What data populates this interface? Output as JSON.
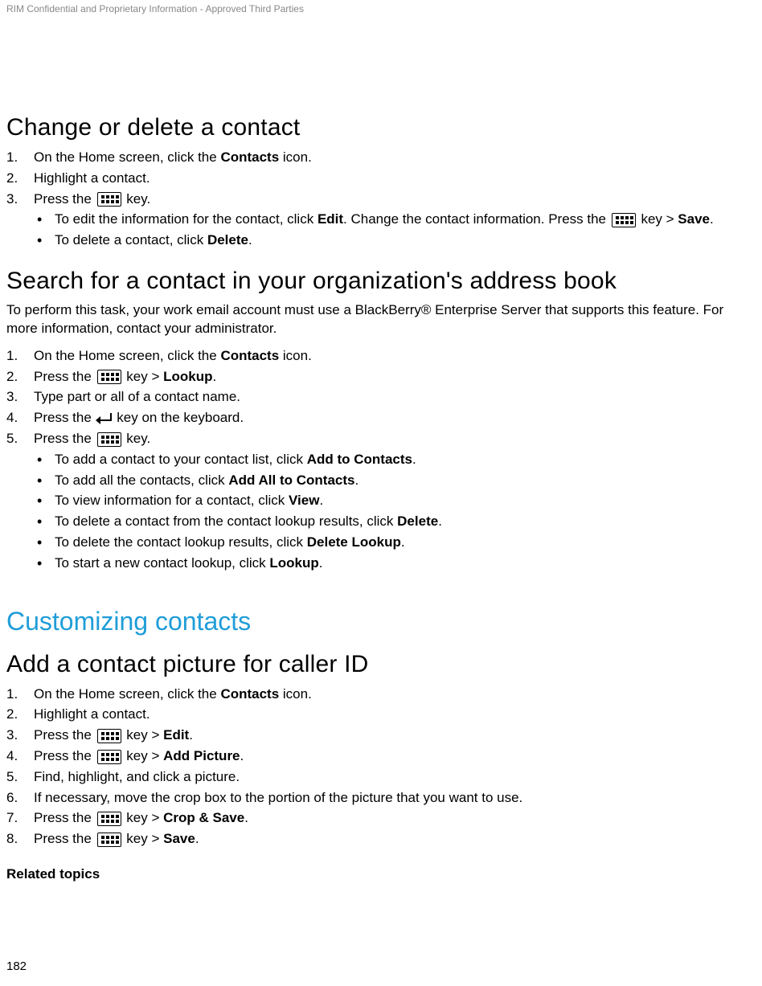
{
  "header": {
    "confidential": "RIM Confidential and Proprietary Information - Approved Third Parties"
  },
  "s1": {
    "title": "Change or delete a contact",
    "step1_a": "On the Home screen, click the ",
    "step1_b": "Contacts",
    "step1_c": " icon.",
    "step2": "Highlight a contact.",
    "step3_a": "Press the ",
    "step3_b": " key.",
    "b1_a": "To edit the information for the contact, click ",
    "b1_b": "Edit",
    "b1_c": ". Change the contact information. Press the ",
    "b1_d": " key > ",
    "b1_e": "Save",
    "b1_f": ".",
    "b2_a": "To delete a contact, click ",
    "b2_b": "Delete",
    "b2_c": "."
  },
  "s2": {
    "title": "Search for a contact in your organization's address book",
    "intro": "To perform this task, your work email account must use a BlackBerry® Enterprise Server that supports this feature. For more information, contact your administrator.",
    "step1_a": "On the Home screen, click the ",
    "step1_b": "Contacts",
    "step1_c": " icon.",
    "step2_a": "Press the ",
    "step2_b": " key > ",
    "step2_c": "Lookup",
    "step2_d": ".",
    "step3": "Type part or all of a contact name.",
    "step4_a": "Press the ",
    "step4_b": " key on the keyboard.",
    "step5_a": "Press the ",
    "step5_b": " key.",
    "b1_a": "To add a contact to your contact list, click ",
    "b1_b": "Add to Contacts",
    "b1_c": ".",
    "b2_a": "To add all the contacts, click ",
    "b2_b": "Add All to Contacts",
    "b2_c": ".",
    "b3_a": "To view information for a contact, click ",
    "b3_b": "View",
    "b3_c": ".",
    "b4_a": "To delete a contact from the contact lookup results, click ",
    "b4_b": "Delete",
    "b4_c": ".",
    "b5_a": "To delete the contact lookup results, click ",
    "b5_b": "Delete Lookup",
    "b5_c": ".",
    "b6_a": "To start a new contact lookup, click ",
    "b6_b": "Lookup",
    "b6_c": "."
  },
  "section_title": "Customizing contacts",
  "s3": {
    "title": "Add a contact picture for caller ID",
    "step1_a": "On the Home screen, click the ",
    "step1_b": "Contacts",
    "step1_c": " icon.",
    "step2": "Highlight a contact.",
    "step3_a": "Press the ",
    "step3_b": " key > ",
    "step3_c": "Edit",
    "step3_d": ".",
    "step4_a": "Press the ",
    "step4_b": " key > ",
    "step4_c": "Add Picture",
    "step4_d": ".",
    "step5": "Find, highlight, and click a picture.",
    "step6": "If necessary, move the crop box to the portion of the picture that you want to use.",
    "step7_a": "Press the ",
    "step7_b": " key > ",
    "step7_c": "Crop & Save",
    "step7_d": ".",
    "step8_a": "Press the ",
    "step8_b": " key > ",
    "step8_c": "Save",
    "step8_d": "."
  },
  "related": "Related topics",
  "page_number": "182"
}
